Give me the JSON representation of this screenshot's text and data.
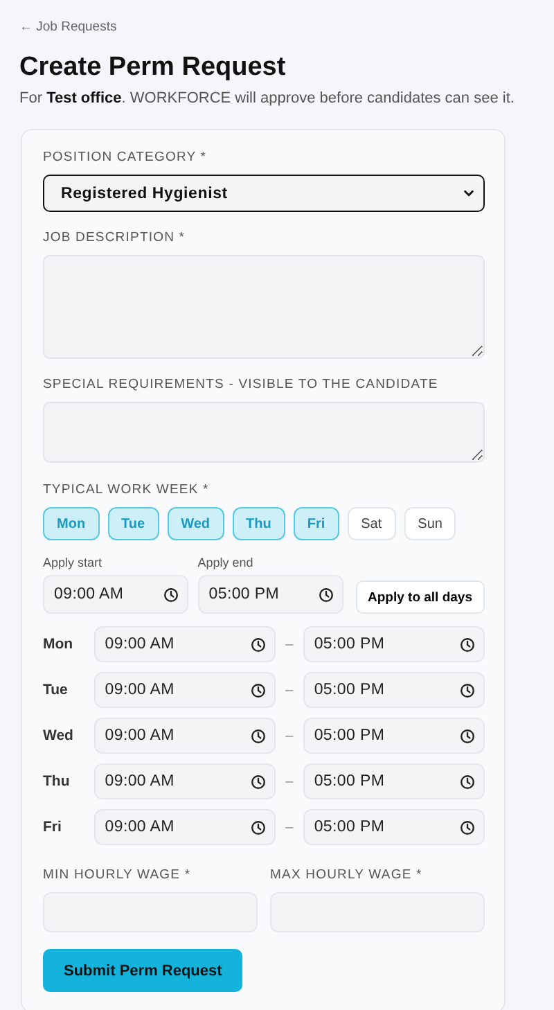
{
  "back_link": "← Job Requests",
  "title": "Create Perm Request",
  "subtitle": "For **Test office**. WORKFORCE will approve before candidates can see it.",
  "position_category": {
    "label": "POSITION CATEGORY *",
    "value": "Registered Hygienist"
  },
  "job_description": {
    "label": "JOB DESCRIPTION *"
  },
  "special_requirements": {
    "label": "SPECIAL REQUIREMENTS - VISIBLE TO THE CANDIDATE"
  },
  "work_week": {
    "label": "TYPICAL WORK WEEK *",
    "days": [
      {
        "label": "Mon",
        "selected": true
      },
      {
        "label": "Tue",
        "selected": true
      },
      {
        "label": "Wed",
        "selected": true
      },
      {
        "label": "Thu",
        "selected": true
      },
      {
        "label": "Fri",
        "selected": true
      },
      {
        "label": "Sat",
        "selected": false
      },
      {
        "label": "Sun",
        "selected": false
      }
    ]
  },
  "apply_start": {
    "label": "Apply start",
    "value": "09:00 AM"
  },
  "apply_end": {
    "label": "Apply end",
    "value": "05:00 PM"
  },
  "apply_button": "Apply to all days",
  "schedule": [
    {
      "day": "Mon",
      "start": "09:00 AM",
      "separator": "–",
      "end": "05:00 PM"
    },
    {
      "day": "Tue",
      "start": "09:00 AM",
      "separator": "–",
      "end": "05:00 PM"
    },
    {
      "day": "Wed",
      "start": "09:00 AM",
      "separator": "–",
      "end": "05:00 PM"
    },
    {
      "day": "Thu",
      "start": "09:00 AM",
      "separator": "–",
      "end": "05:00 PM"
    },
    {
      "day": "Fri",
      "start": "09:00 AM",
      "separator": "–",
      "end": "05:00 PM"
    }
  ],
  "min_wage": {
    "label": "MIN HOURLY WAGE *"
  },
  "max_wage": {
    "label": "MAX HOURLY WAGE *"
  },
  "submit_button": "Submit Perm Request"
}
